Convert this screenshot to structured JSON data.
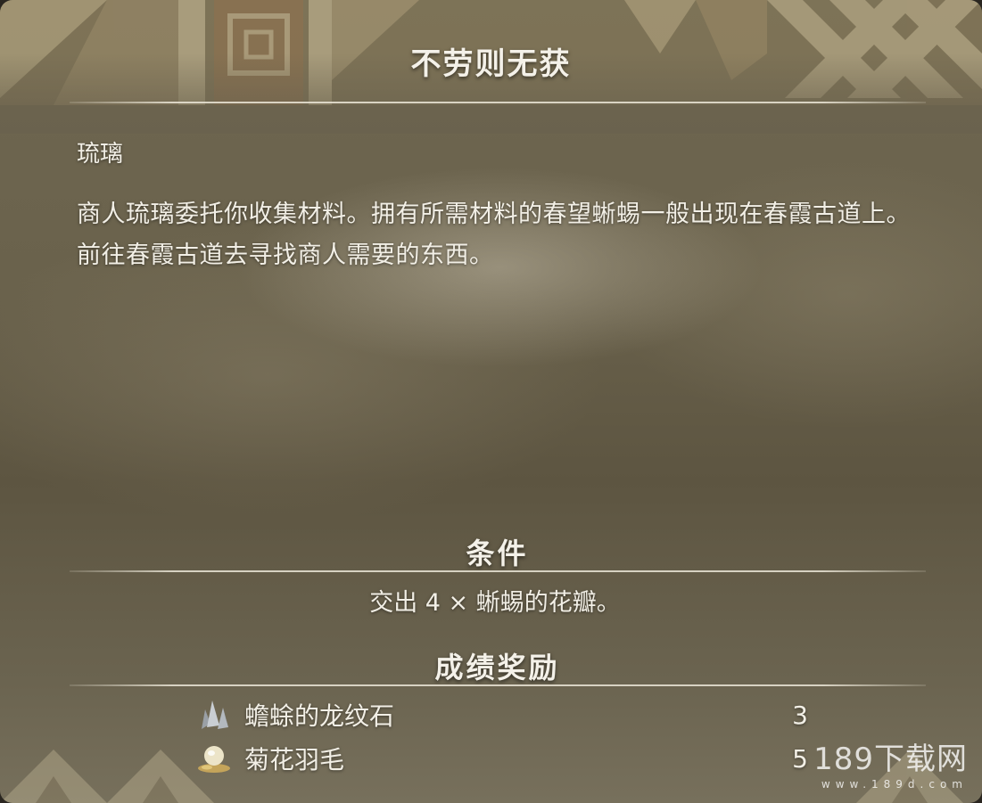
{
  "quest": {
    "title": "不劳则无获",
    "client": "琉璃",
    "description": "商人琉璃委托你收集材料。拥有所需材料的春望蜥蜴一般出现在春霞古道上。前往春霞古道去寻找商人需要的东西。"
  },
  "conditions": {
    "heading": "条件",
    "text": "交出 4 × 蜥蜴的花瓣。"
  },
  "rewards": {
    "heading": "成绩奖励",
    "items": [
      {
        "name": "蟾蜍的龙纹石",
        "quantity": "3",
        "icon": "ore-crystal-icon"
      },
      {
        "name": "菊花羽毛",
        "quantity": "5",
        "icon": "feather-egg-icon"
      }
    ]
  },
  "watermark": {
    "main": "189下载网",
    "sub": "www.189d.com"
  },
  "colors": {
    "text": "#f2efe6",
    "panel": "#6a624c",
    "rule": "#ebe6d7"
  }
}
